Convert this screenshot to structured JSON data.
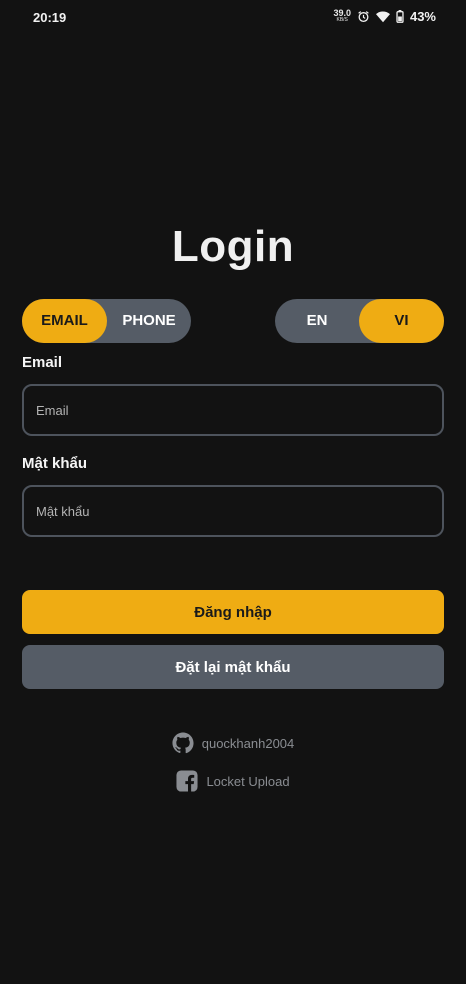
{
  "status_bar": {
    "time": "20:19",
    "net_speed_value": "39.0",
    "net_speed_unit": "KB/S",
    "battery": "43%",
    "icons": [
      "alarm-icon",
      "wifi-icon",
      "battery-icon"
    ]
  },
  "title": "Login",
  "login_method": {
    "options": [
      "EMAIL",
      "PHONE"
    ],
    "selected": "EMAIL"
  },
  "language": {
    "options": [
      "EN",
      "VI"
    ],
    "selected": "VI"
  },
  "email": {
    "label": "Email",
    "placeholder": "Email",
    "value": ""
  },
  "password": {
    "label": "Mật khẩu",
    "placeholder": "Mật khẩu",
    "value": ""
  },
  "buttons": {
    "login": "Đăng nhập",
    "reset_password": "Đặt lại mật khẩu"
  },
  "links": {
    "github": {
      "text": "quockhanh2004",
      "icon": "github-icon"
    },
    "facebook": {
      "text": "Locket Upload",
      "icon": "facebook-icon"
    }
  },
  "colors": {
    "background": "#121212",
    "accent": "#efac13",
    "secondary": "#555c66",
    "input_border": "#4d535c",
    "link_text": "#8a8d92"
  }
}
